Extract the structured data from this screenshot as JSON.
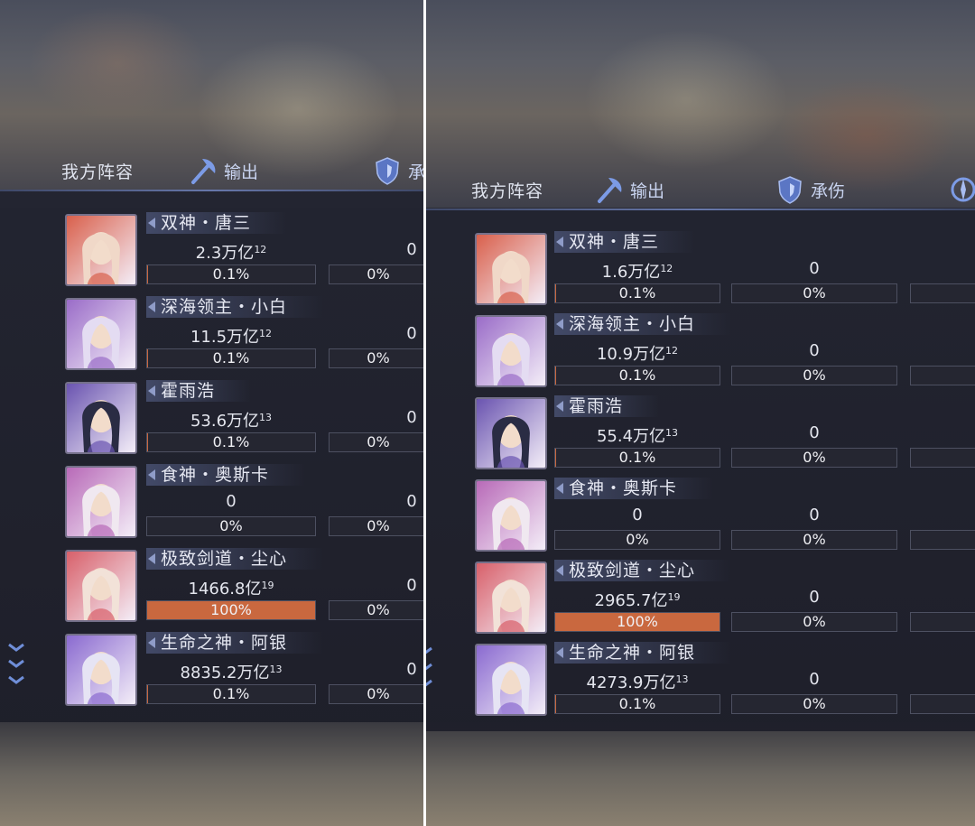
{
  "screens": [
    {
      "team_label": "我方阵容",
      "tabs": [
        {
          "label": "输出",
          "icon": "axe-icon"
        },
        {
          "label": "承",
          "icon": "shield-icon"
        }
      ],
      "heroes": [
        {
          "name": "双神・唐三",
          "output": "2.3万亿",
          "output_exp": "12",
          "output_pct": "0.1%",
          "output_fill": 0.001,
          "tank": "0",
          "tank_pct": "0%"
        },
        {
          "name": "深海领主・小白",
          "output": "11.5万亿",
          "output_exp": "12",
          "output_pct": "0.1%",
          "output_fill": 0.001,
          "tank": "0",
          "tank_pct": "0%"
        },
        {
          "name": "霍雨浩",
          "output": "53.6万亿",
          "output_exp": "13",
          "output_pct": "0.1%",
          "output_fill": 0.001,
          "tank": "0",
          "tank_pct": "0%"
        },
        {
          "name": "食神・奥斯卡",
          "output": "0",
          "output_exp": "",
          "output_pct": "0%",
          "output_fill": 0,
          "tank": "0",
          "tank_pct": "0%"
        },
        {
          "name": "极致剑道・尘心",
          "output": "1466.8亿",
          "output_exp": "19",
          "output_pct": "100%",
          "output_fill": 1.0,
          "tank": "0",
          "tank_pct": "0%"
        },
        {
          "name": "生命之神・阿银",
          "output": "8835.2万亿",
          "output_exp": "13",
          "output_pct": "0.1%",
          "output_fill": 0.001,
          "tank": "0",
          "tank_pct": "0%"
        }
      ]
    },
    {
      "team_label": "我方阵容",
      "tabs": [
        {
          "label": "输出",
          "icon": "axe-icon"
        },
        {
          "label": "承伤",
          "icon": "shield-icon"
        }
      ],
      "heroes": [
        {
          "name": "双神・唐三",
          "output": "1.6万亿",
          "output_exp": "12",
          "output_pct": "0.1%",
          "output_fill": 0.001,
          "tank": "0",
          "tank_pct": "0%"
        },
        {
          "name": "深海领主・小白",
          "output": "10.9万亿",
          "output_exp": "12",
          "output_pct": "0.1%",
          "output_fill": 0.001,
          "tank": "0",
          "tank_pct": "0%"
        },
        {
          "name": "霍雨浩",
          "output": "55.4万亿",
          "output_exp": "13",
          "output_pct": "0.1%",
          "output_fill": 0.001,
          "tank": "0",
          "tank_pct": "0%"
        },
        {
          "name": "食神・奥斯卡",
          "output": "0",
          "output_exp": "",
          "output_pct": "0%",
          "output_fill": 0,
          "tank": "0",
          "tank_pct": "0%"
        },
        {
          "name": "极致剑道・尘心",
          "output": "2965.7亿",
          "output_exp": "19",
          "output_pct": "100%",
          "output_fill": 1.0,
          "tank": "0",
          "tank_pct": "0%"
        },
        {
          "name": "生命之神・阿银",
          "output": "4273.9万亿",
          "output_exp": "13",
          "output_pct": "0.1%",
          "output_fill": 0.001,
          "tank": "0",
          "tank_pct": "0%"
        }
      ]
    }
  ],
  "avatar_colors": [
    [
      "#d9604c",
      "#f0d8c8"
    ],
    [
      "#9a6cc8",
      "#e4dcf2"
    ],
    [
      "#6a54b0",
      "#2a2c44"
    ],
    [
      "#b86ab8",
      "#f0e8f0"
    ],
    [
      "#d8606a",
      "#f2e2d8"
    ],
    [
      "#8a6ad0",
      "#e6e4f4"
    ]
  ],
  "colors": {
    "bar_fill_accent": "#c9683f",
    "tab_accent": "#6e8ee0"
  }
}
